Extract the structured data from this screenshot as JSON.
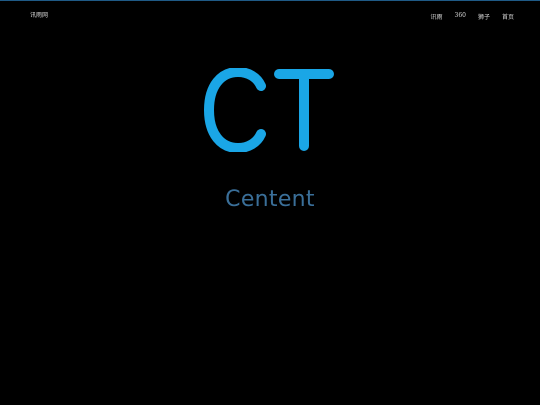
{
  "header": {
    "site_name": "讯雨网",
    "nav": [
      {
        "label": "讯雨"
      },
      {
        "label": "360"
      },
      {
        "label": "狮子"
      },
      {
        "label": "首页"
      }
    ]
  },
  "hero": {
    "logo_letters": "CT",
    "tagline": "Centent"
  },
  "colors": {
    "background": "#000000",
    "logo_blue": "#1aa6e6",
    "tagline_blue": "#3a6f99",
    "accent_line": "#1f5a86",
    "nav_text": "#d9d9d9"
  }
}
